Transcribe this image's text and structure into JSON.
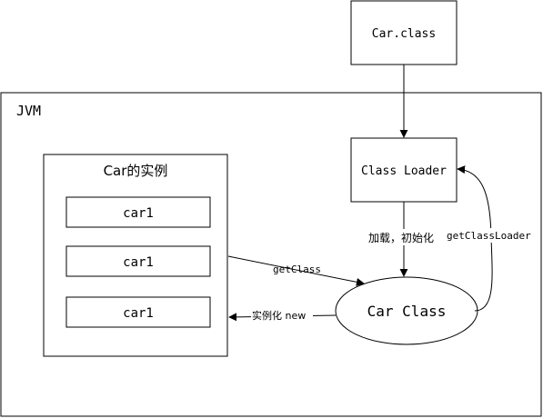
{
  "diagram": {
    "file_box": {
      "label": "Car.class"
    },
    "jvm_box": {
      "label": "JVM"
    },
    "instances_box": {
      "title": "Car的实例",
      "items": [
        "car1",
        "car1",
        "car1"
      ]
    },
    "class_loader_box": {
      "label": "Class Loader"
    },
    "car_class_ellipse": {
      "label": "Car Class"
    },
    "edges": {
      "load_init": "加载，初始化",
      "get_class_loader": "getClassLoader",
      "get_class": "getClass",
      "instantiate": "实例化 new"
    }
  }
}
